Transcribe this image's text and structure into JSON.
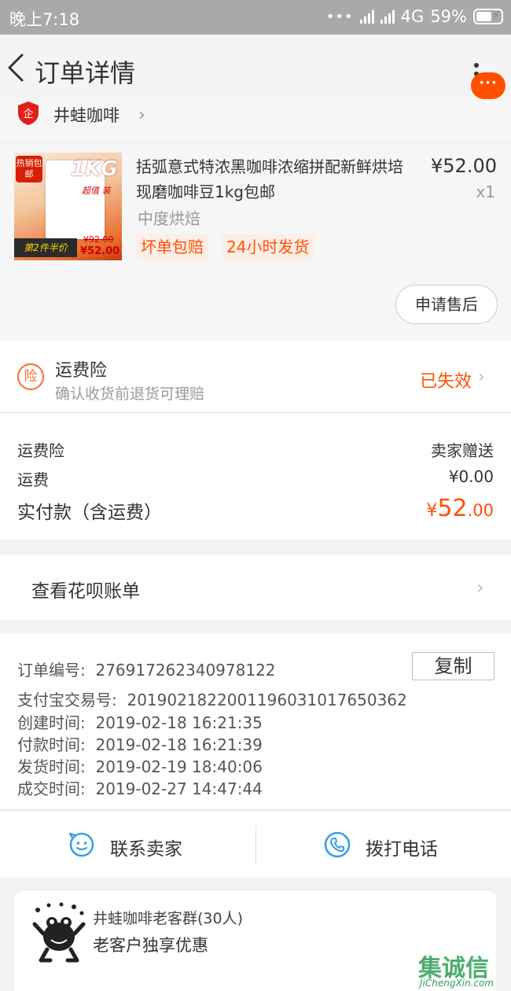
{
  "status_bar": {
    "time": "晚上7:18",
    "network": "4G",
    "battery": "59%"
  },
  "nav": {
    "title": "订单详情",
    "menu_dots": "···"
  },
  "shop": {
    "name": "井蛙咖啡",
    "badge": "企"
  },
  "product": {
    "image_text": {
      "hot": "热销包邮",
      "kg": "1KG",
      "super": "超值 装",
      "half": "第2件半价",
      "old_price": "¥92.00",
      "new_price": "¥52.00"
    },
    "title": "括弧意式特浓黑咖啡浓缩拼配新鲜烘培现磨咖啡豆1kg包邮",
    "price": "¥52.00",
    "qty": "x1",
    "sku": "中度烘焙",
    "tags": [
      "坏单包赔",
      "24小时发货"
    ],
    "after_sale": "申请售后"
  },
  "insurance": {
    "icon": "险",
    "title": "运费险",
    "subtitle": "确认收货前退货可理赔",
    "status": "已失效",
    "status_color": "#ff5000"
  },
  "fees": [
    {
      "label": "运费险",
      "value": "卖家赠送"
    },
    {
      "label": "运费",
      "value": "¥0.00"
    }
  ],
  "total": {
    "label": "实付款（含运费）",
    "currency": "¥",
    "integer": "52",
    "decimal": ".00"
  },
  "huabei": {
    "label": "查看花呗账单"
  },
  "order_info": {
    "copy_label": "复制",
    "rows": [
      {
        "key": "订单编号:",
        "value": "276917262340978122"
      },
      {
        "key": "支付宝交易号:",
        "value": "2019021822001196031017650362"
      },
      {
        "key": "创建时间:",
        "value": "2019-02-18 16:21:35"
      },
      {
        "key": "付款时间:",
        "value": "2019-02-18 16:21:39"
      },
      {
        "key": "发货时间:",
        "value": "2019-02-19 18:40:06"
      },
      {
        "key": "成交时间:",
        "value": "2019-02-27 14:47:44"
      }
    ]
  },
  "contact": {
    "seller": "联系卖家",
    "phone": "拨打电话"
  },
  "group": {
    "name": "井蛙咖啡老客群(30人)",
    "desc": "老客户独享优惠"
  },
  "watermark": {
    "top": "集诚信",
    "bottom": "JiChengXin.com"
  },
  "colors": {
    "accent": "#ff5000",
    "icon_blue": "#3aa0e8",
    "status_bar_bg": "#a9a9a9"
  }
}
